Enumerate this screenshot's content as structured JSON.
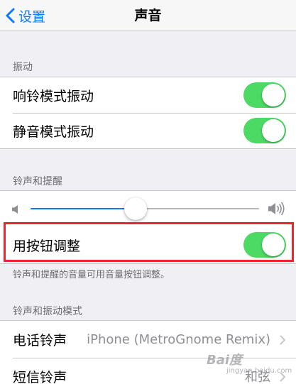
{
  "navbar": {
    "back_label": "设置",
    "title": "声音"
  },
  "vibrate_section": {
    "header": "振动",
    "items": [
      {
        "label": "响铃模式振动",
        "on": true
      },
      {
        "label": "静音模式振动",
        "on": true
      }
    ]
  },
  "ringer_section": {
    "header": "铃声和提醒",
    "volume_level": 0.46,
    "change_with_buttons": {
      "label": "用按钮调整",
      "on": true
    },
    "footer": "铃声和提醒的音量可用音量按钮调整。"
  },
  "sounds_section": {
    "header": "铃声和振动模式",
    "items": [
      {
        "label": "电话铃声",
        "value": "iPhone (MetroGnome Remix)"
      },
      {
        "label": "短信铃声",
        "value": "和弦"
      }
    ]
  },
  "watermark": {
    "brand": "Bai度",
    "sub": "jingyan.baidu.com"
  },
  "colors": {
    "accent": "#0a7aff",
    "switch_on": "#4cd964",
    "highlight": "#e8262b",
    "background": "#efeff4"
  },
  "icons": {
    "back": "chevron-left-icon",
    "volume_low": "speaker-low-icon",
    "volume_high": "speaker-high-icon",
    "disclosure": "chevron-right-icon"
  }
}
